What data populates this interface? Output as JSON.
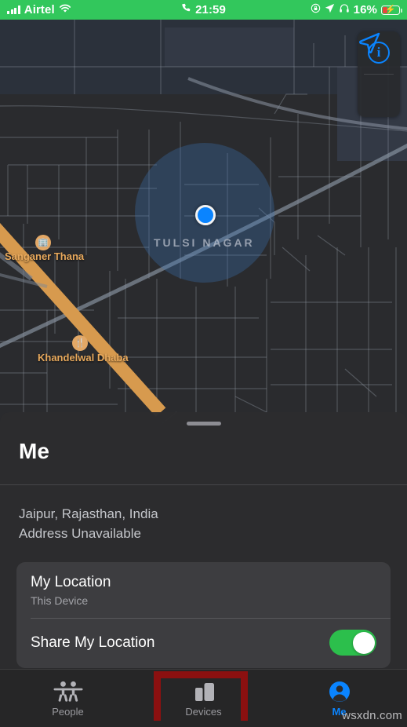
{
  "status_bar": {
    "carrier": "Airtel",
    "signal_icon": "cellular-bars-icon",
    "wifi_icon": "wifi-icon",
    "call_icon": "phone-call-icon",
    "time": "21:59",
    "orientation_lock_icon": "rotation-lock-icon",
    "location_icon": "location-arrow-icon",
    "headphones_icon": "headphones-icon",
    "battery_percent": "16%",
    "battery_icon": "battery-charging-icon",
    "background_color": "#32C75C"
  },
  "map": {
    "neighborhood_label": "TULSI NAGAR",
    "pois": [
      {
        "name": "Sanganer Thana",
        "icon": "government-building-icon"
      },
      {
        "name": "Khandelwal Dhaba",
        "icon": "restaurant-fork-knife-icon"
      }
    ],
    "user_location_icon": "blue-location-dot",
    "controls": {
      "info_label": "i",
      "info_icon": "info-circle-icon",
      "locate_icon": "navigation-arrow-icon"
    },
    "accent_color": "#0A84FF",
    "road_color": "#D79A4E"
  },
  "sheet": {
    "grabber_icon": "sheet-grabber-handle",
    "title": "Me",
    "address_line1": "Jaipur, Rajasthan, India",
    "address_line2": "Address Unavailable",
    "my_location": {
      "title": "My Location",
      "subtitle": "This Device"
    },
    "share_my_location": {
      "label": "Share My Location",
      "state": "on",
      "on_color": "#2CBF4C"
    }
  },
  "tab_bar": {
    "tabs": [
      {
        "label": "People",
        "icon": "two-people-icon",
        "selected": false
      },
      {
        "label": "Devices",
        "icon": "devices-icon",
        "selected": false
      },
      {
        "label": "Me",
        "icon": "person-circle-icon",
        "selected": true
      }
    ],
    "selected_color": "#0A84FF",
    "inactive_color": "#9A9A9F"
  },
  "annotation": {
    "highlight_target": "Devices",
    "color": "#8B1010"
  },
  "watermark": {
    "text": "wsxdn.com"
  }
}
